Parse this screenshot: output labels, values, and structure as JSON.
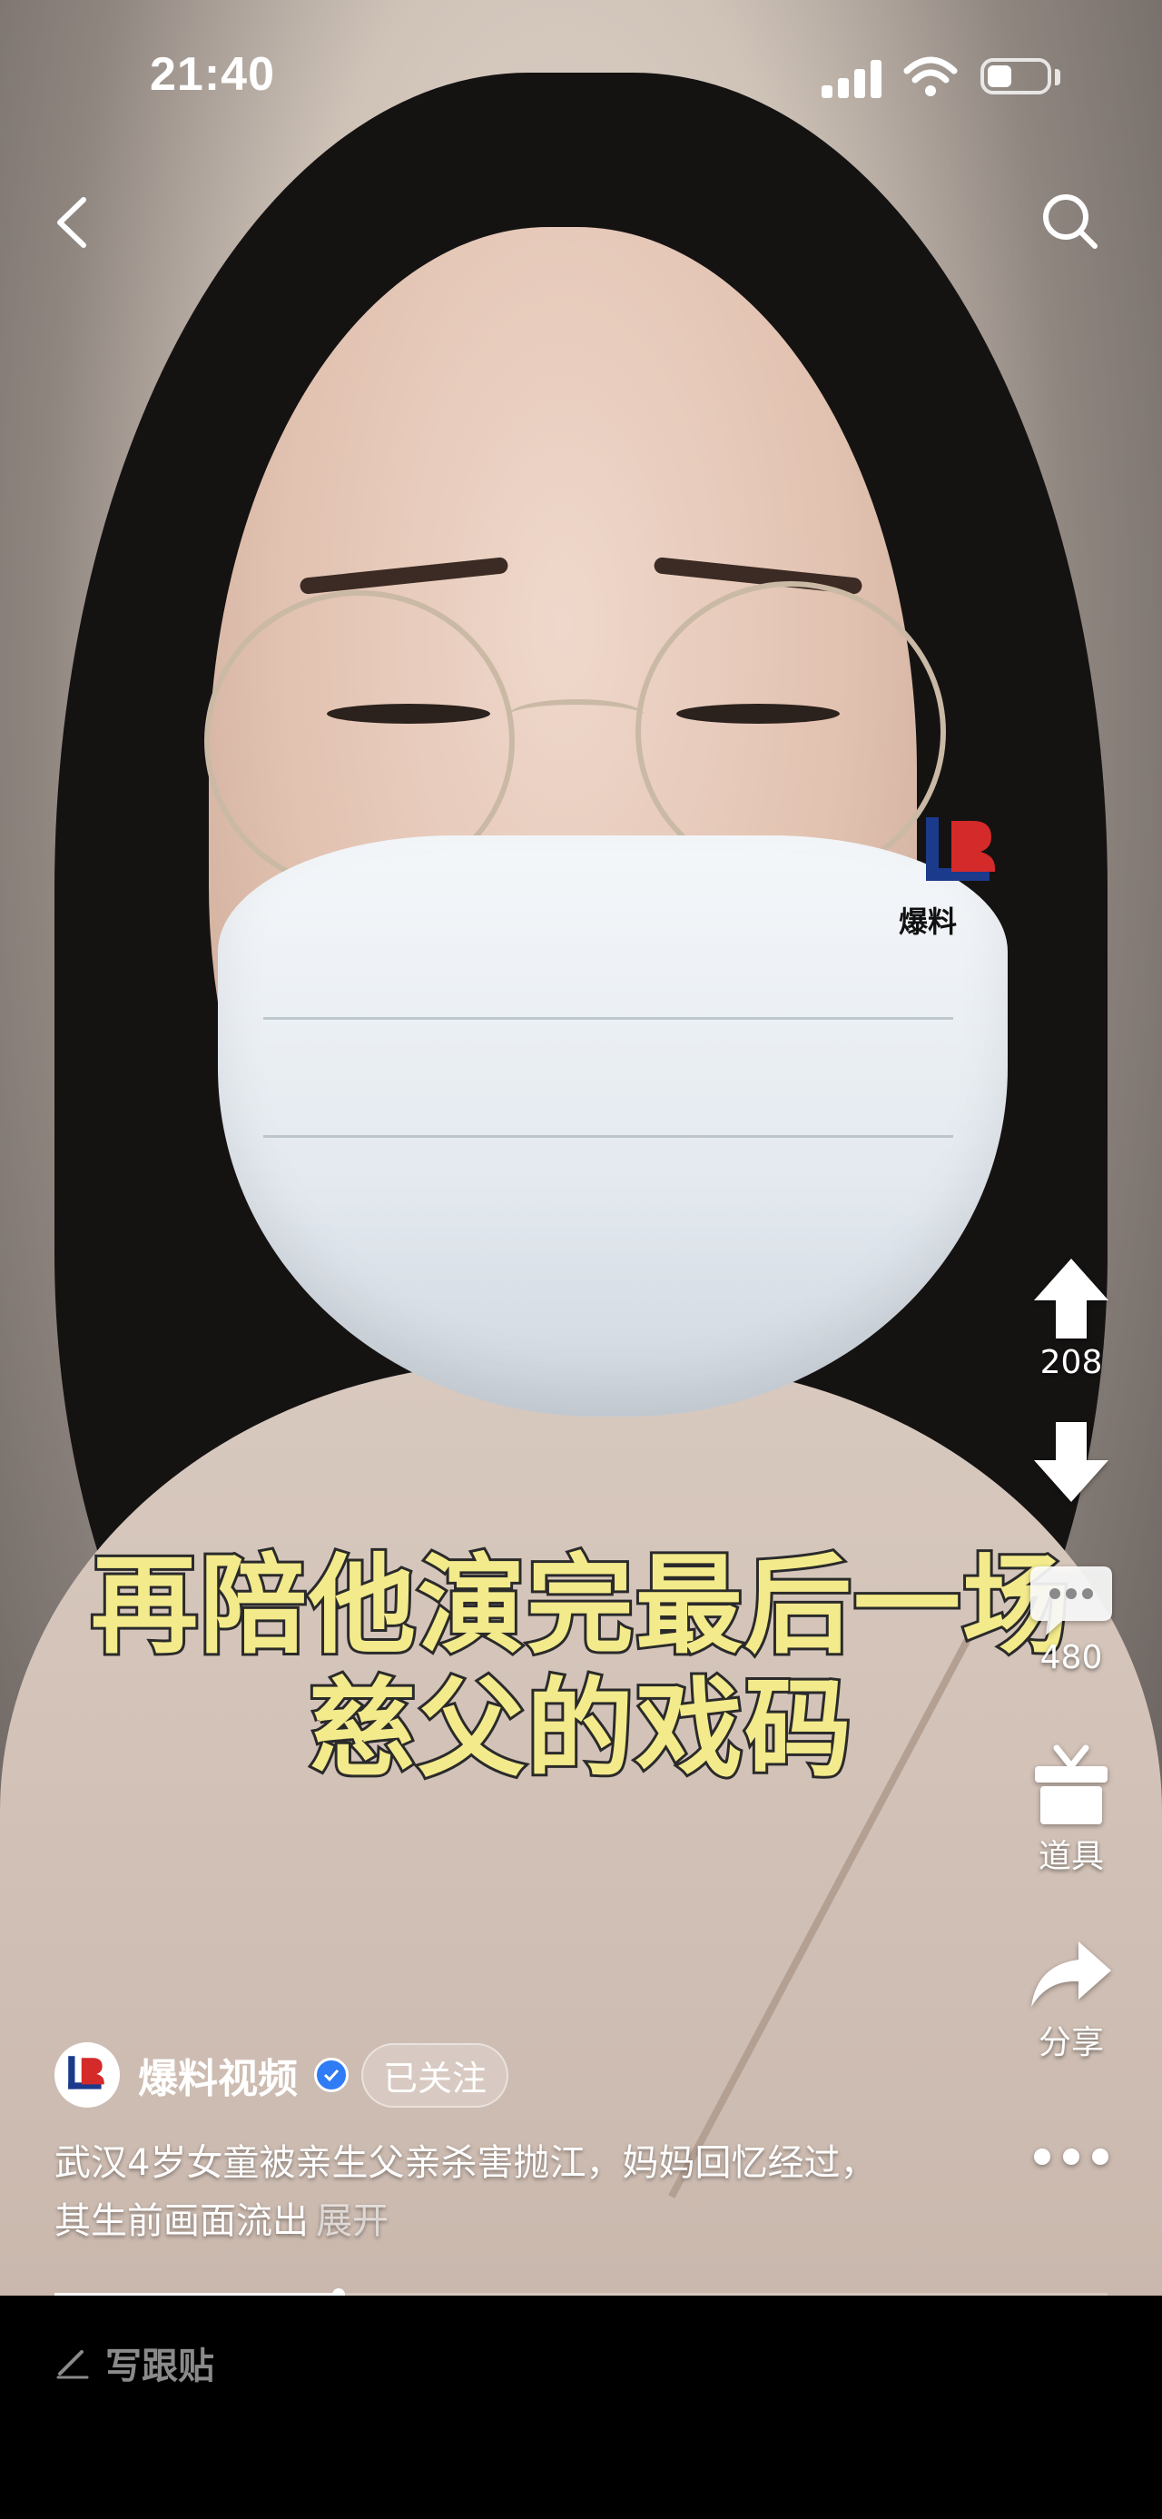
{
  "status_bar": {
    "time": "21:40",
    "icons": [
      "signal-icon",
      "wifi-icon",
      "battery-charging-icon"
    ]
  },
  "nav": {
    "back_icon": "chevron-left-icon",
    "search_icon": "search-icon"
  },
  "video": {
    "subtitle_line1": "再陪他演完最后一场",
    "subtitle_line2": "慈父的戏码",
    "watermark_text": "爆料",
    "progress": 0.27
  },
  "actions": {
    "upvote_count": "208",
    "comment_count": "480",
    "props_label": "道具",
    "share_label": "分享"
  },
  "author": {
    "name": "爆料视频",
    "follow_status": "已关注"
  },
  "description": {
    "text": "武汉4岁女童被亲生父亲杀害抛江，妈妈回忆经过，其生前画面流出",
    "expand_label": "展开"
  },
  "bottom_bar": {
    "compose_label": "写跟贴"
  },
  "colors": {
    "subtitle": "#f3ea8c",
    "verified": "#2f7cf6",
    "background": "#000000"
  }
}
